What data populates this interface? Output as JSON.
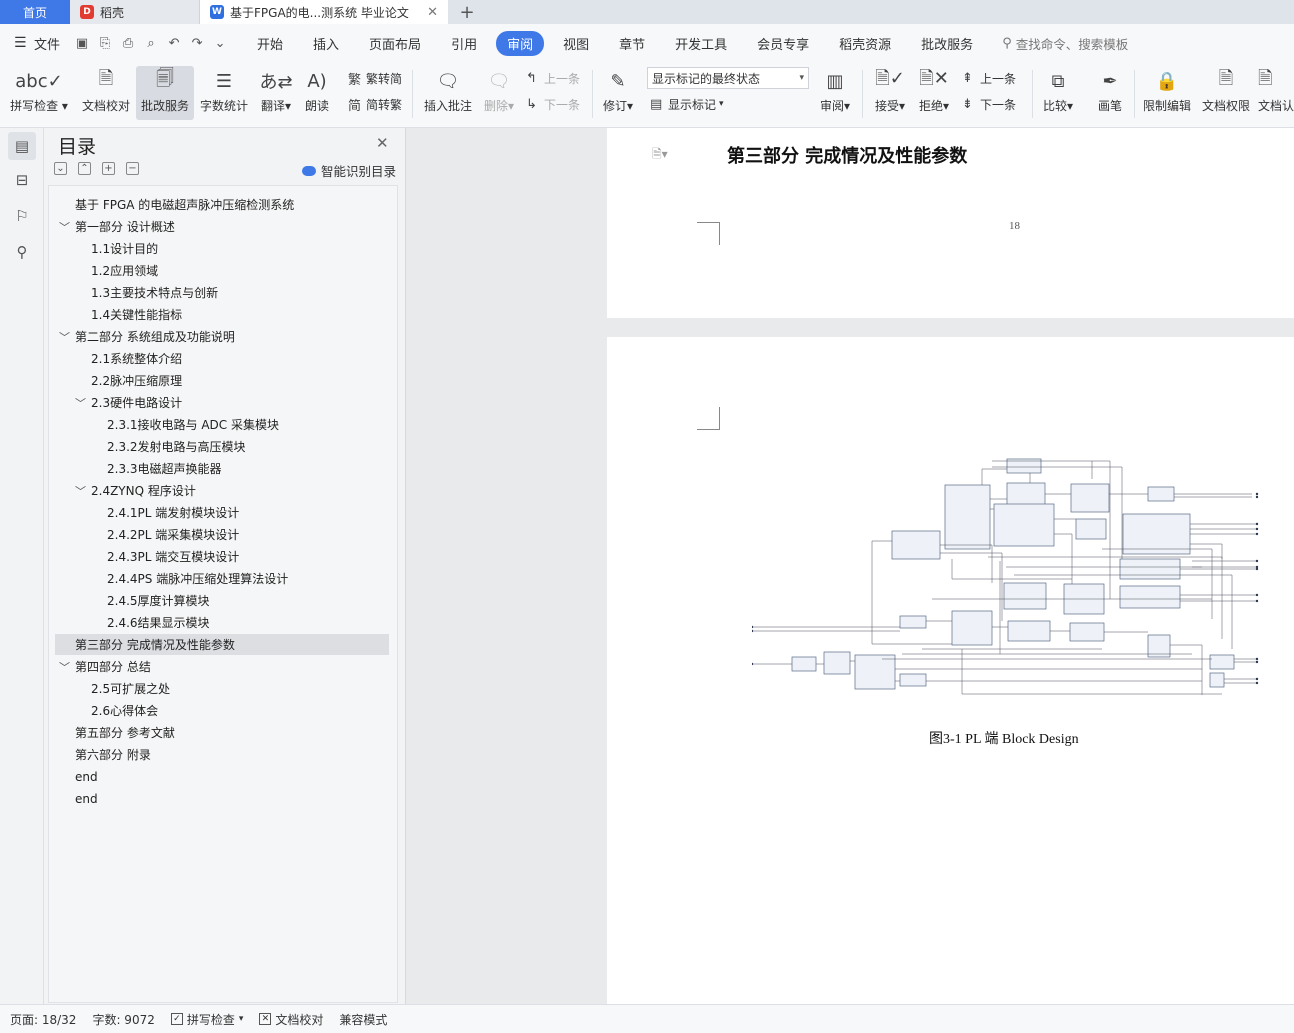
{
  "tabs": {
    "home": "首页",
    "daoke": "稻壳",
    "doc": "基于FPGA的电...测系统 毕业论文",
    "add": "+",
    "close": "✕"
  },
  "menu": {
    "file": "文件",
    "items": [
      "开始",
      "插入",
      "页面布局",
      "引用",
      "审阅",
      "视图",
      "章节",
      "开发工具",
      "会员专享",
      "稻壳资源",
      "批改服务"
    ],
    "active_item": "审阅",
    "search_placeholder": "查找命令、搜索模板"
  },
  "ribbon": {
    "spellcheck": "拼写检查",
    "doc_proof": "文档校对",
    "revise_service": "批改服务",
    "word_count": "字数统计",
    "translate": "翻译",
    "read_aloud": "朗读",
    "to_traditional": "繁转简",
    "to_simplified": "简转繁",
    "insert_comment": "插入批注",
    "delete": "删除",
    "prev_comment": "上一条",
    "next_comment": "下一条",
    "track_changes": "修订",
    "display_state": "显示标记的最终状态",
    "show_markup": "显示标记",
    "review": "审阅",
    "accept": "接受",
    "reject": "拒绝",
    "prev_change": "上一条",
    "next_change": "下一条",
    "compare": "比较",
    "pen": "画笔",
    "restrict_edit": "限制编辑",
    "doc_permission": "文档权限",
    "doc_cert": "文档认"
  },
  "toc": {
    "title": "目录",
    "ai_recognize": "智能识别目录",
    "items": [
      {
        "text": "基于 FPGA 的电磁超声脉冲压缩检测系统",
        "level": 0,
        "arrow": ""
      },
      {
        "text": "第一部分  设计概述",
        "level": 0,
        "arrow": "﹀"
      },
      {
        "text": "1.1设计目的",
        "level": 1,
        "arrow": ""
      },
      {
        "text": "1.2应用领域",
        "level": 1,
        "arrow": ""
      },
      {
        "text": "1.3主要技术特点与创新",
        "level": 1,
        "arrow": ""
      },
      {
        "text": "1.4关键性能指标",
        "level": 1,
        "arrow": ""
      },
      {
        "text": "第二部分  系统组成及功能说明",
        "level": 0,
        "arrow": "﹀"
      },
      {
        "text": "2.1系统整体介绍",
        "level": 1,
        "arrow": ""
      },
      {
        "text": "2.2脉冲压缩原理",
        "level": 1,
        "arrow": ""
      },
      {
        "text": "2.3硬件电路设计",
        "level": 1,
        "arrow": "﹀"
      },
      {
        "text": "2.3.1接收电路与 ADC 采集模块",
        "level": 2,
        "arrow": ""
      },
      {
        "text": "2.3.2发射电路与高压模块",
        "level": 2,
        "arrow": ""
      },
      {
        "text": "2.3.3电磁超声换能器",
        "level": 2,
        "arrow": ""
      },
      {
        "text": "2.4ZYNQ 程序设计",
        "level": 1,
        "arrow": "﹀"
      },
      {
        "text": "2.4.1PL 端发射模块设计",
        "level": 2,
        "arrow": ""
      },
      {
        "text": "2.4.2PL 端采集模块设计",
        "level": 2,
        "arrow": ""
      },
      {
        "text": "2.4.3PL 端交互模块设计",
        "level": 2,
        "arrow": ""
      },
      {
        "text": "2.4.4PS 端脉冲压缩处理算法设计",
        "level": 2,
        "arrow": ""
      },
      {
        "text": "2.4.5厚度计算模块",
        "level": 2,
        "arrow": ""
      },
      {
        "text": "2.4.6结果显示模块",
        "level": 2,
        "arrow": ""
      },
      {
        "text": "第三部分  完成情况及性能参数",
        "level": 0,
        "arrow": ""
      },
      {
        "text": "第四部分  总结",
        "level": 0,
        "arrow": "﹀"
      },
      {
        "text": "2.5可扩展之处",
        "level": 1,
        "arrow": ""
      },
      {
        "text": "2.6心得体会",
        "level": 1,
        "arrow": ""
      },
      {
        "text": "第五部分  参考文献",
        "level": 0,
        "arrow": ""
      },
      {
        "text": "第六部分  附录",
        "level": 0,
        "arrow": ""
      },
      {
        "text": "end",
        "level": 0,
        "arrow": ""
      },
      {
        "text": "end",
        "level": 0,
        "arrow": ""
      }
    ],
    "highlighted": "第三部分  完成情况及性能参数"
  },
  "document": {
    "heading": "第三部分   完成情况及性能参数",
    "page_number": "18",
    "figure_caption": "图3-1 PL 端 Block Design"
  },
  "status": {
    "page": "页面: 18/32",
    "word_count": "字数: 9072",
    "spellcheck": "拼写检查",
    "doc_proof": "文档校对",
    "compat_mode": "兼容模式"
  },
  "colors": {
    "accent": "#3f79e8",
    "toc_highlight": "#dcdee2"
  }
}
